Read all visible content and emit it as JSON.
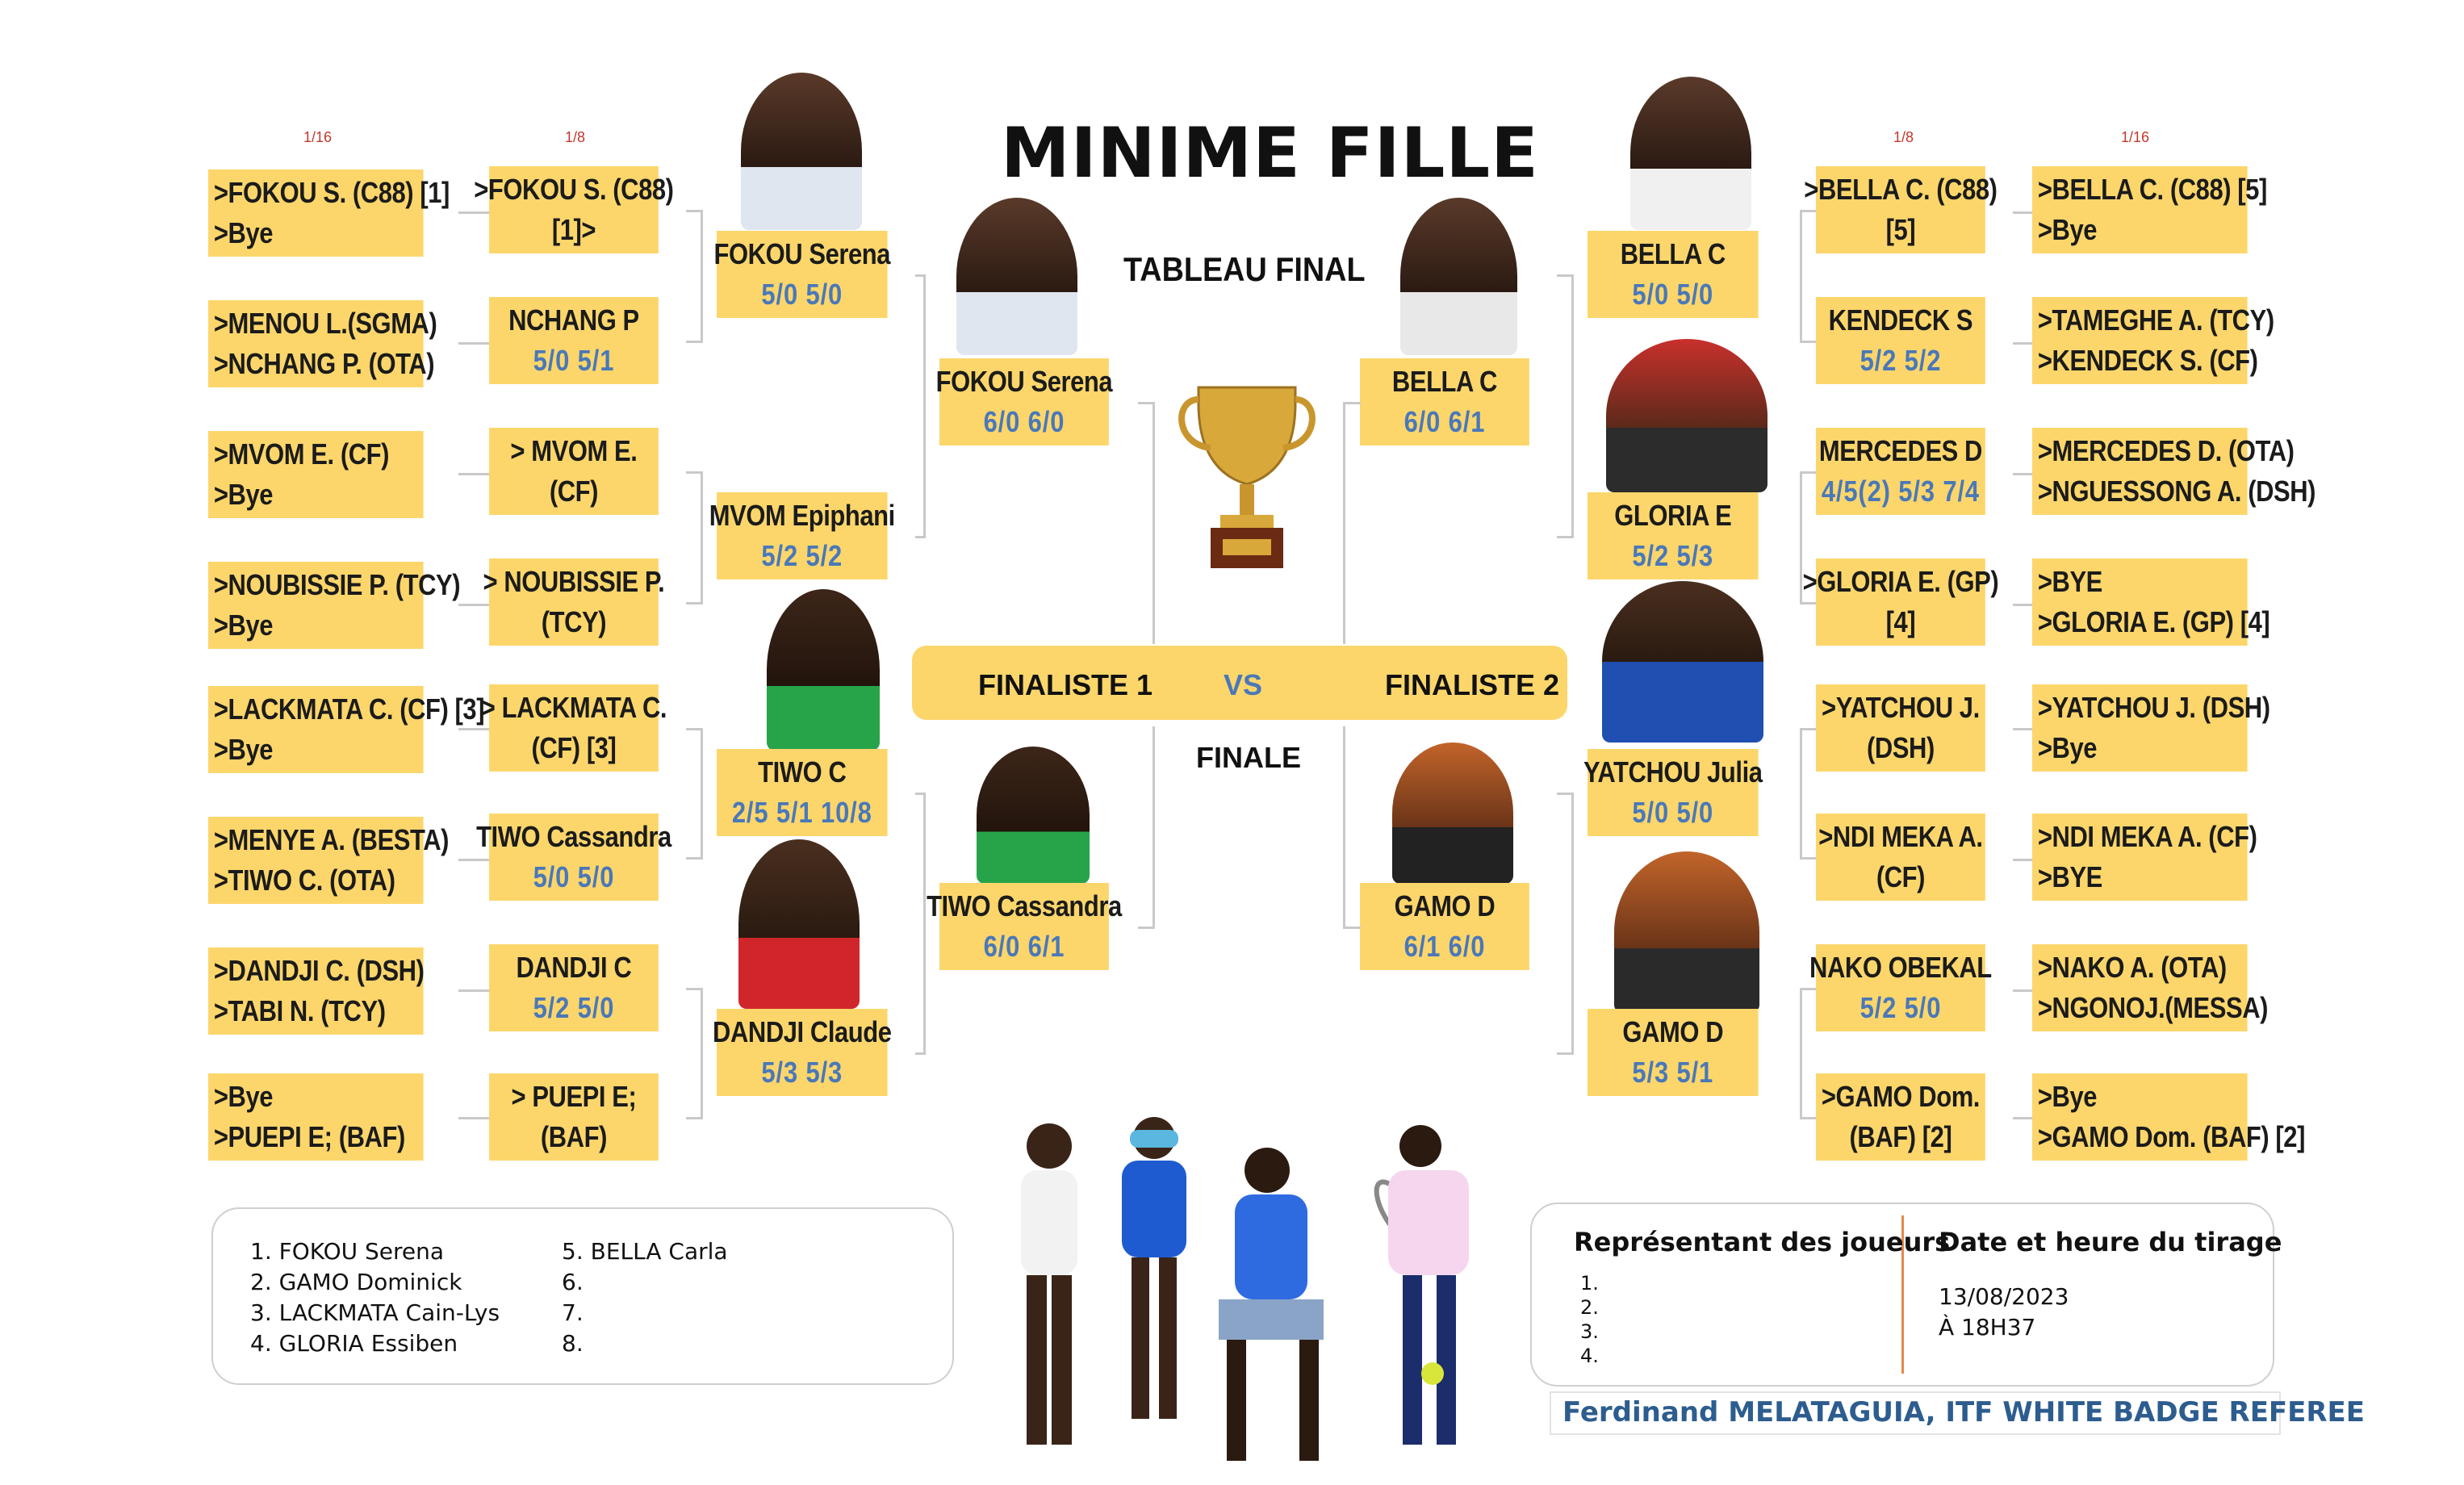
{
  "title": "MINIME FILLE",
  "subtitle": "TABLEAU FINAL",
  "finale_label": "FINALE",
  "finalist1": "FINALISTE 1",
  "vs": "VS",
  "finalist2": "FINALISTE 2",
  "round_labels": {
    "r16_left": "1/16",
    "r8_left": "1/8",
    "r8_right": "1/8",
    "r16_right": "1/16"
  },
  "left": {
    "r16": [
      [
        ">FOKOU S. (C88) [1]",
        ">Bye"
      ],
      [
        ">MENOU L.(SGMA)",
        ">NCHANG P. (OTA)"
      ],
      [
        ">MVOM E. (CF)",
        ">Bye"
      ],
      [
        ">NOUBISSIE P. (TCY)",
        ">Bye"
      ],
      [
        ">LACKMATA C. (CF) [3]",
        ">Bye"
      ],
      [
        ">MENYE A. (BESTA)",
        ">TIWO C. (OTA)"
      ],
      [
        ">DANDJI C. (DSH)",
        ">TABI N. (TCY)"
      ],
      [
        ">Bye",
        ">PUEPI E; (BAF)"
      ]
    ],
    "r8": [
      [
        ">FOKOU S. (C88)",
        "[1]>"
      ],
      [
        "NCHANG P",
        "5/0 5/1"
      ],
      [
        "> MVOM E.",
        "(CF)"
      ],
      [
        "> NOUBISSIE P.",
        "(TCY)"
      ],
      [
        "> LACKMATA C.",
        "(CF) [3]"
      ],
      [
        "TIWO Cassandra",
        "5/0 5/0"
      ],
      [
        "DANDJI C",
        "5/2  5/0"
      ],
      [
        "> PUEPI E;",
        "(BAF)"
      ]
    ],
    "qf": [
      [
        "FOKOU  Serena",
        "5/0  5/0"
      ],
      [
        "MVOM Epiphani",
        "5/2  5/2"
      ],
      [
        "TIWO C",
        "2/5  5/1   10/8"
      ],
      [
        "DANDJI Claude",
        "5/3  5/3"
      ]
    ],
    "sf": [
      [
        "FOKOU  Serena",
        "6/0  6/0"
      ],
      [
        "TIWO Cassandra",
        "6/0  6/1"
      ]
    ]
  },
  "right": {
    "sf": [
      [
        "BELLA C",
        "6/0  6/1"
      ],
      [
        "GAMO D",
        "6/1  6/0"
      ]
    ],
    "qf": [
      [
        "BELLA C",
        "5/0  5/0"
      ],
      [
        "GLORIA E",
        "5/2  5/3"
      ],
      [
        "YATCHOU Julia",
        "5/0  5/0"
      ],
      [
        "GAMO D",
        "5/3  5/1"
      ]
    ],
    "r8": [
      [
        ">BELLA C. (C88)",
        "[5]"
      ],
      [
        "KENDECK  S",
        "5/2  5/2"
      ],
      [
        "MERCEDES D",
        "4/5(2)  5/3  7/4"
      ],
      [
        ">GLORIA E. (GP)",
        "[4]"
      ],
      [
        ">YATCHOU J.",
        "(DSH)"
      ],
      [
        ">NDI MEKA A.",
        "(CF)"
      ],
      [
        "NAKO OBEKAL",
        "5/2  5/0"
      ],
      [
        ">GAMO Dom.",
        "(BAF) [2]"
      ]
    ],
    "r16": [
      [
        ">BELLA C. (C88) [5]",
        ">Bye"
      ],
      [
        ">TAMEGHE A. (TCY)",
        ">KENDECK S. (CF)"
      ],
      [
        ">MERCEDES D. (OTA)",
        ">NGUESSONG A. (DSH)"
      ],
      [
        ">BYE",
        ">GLORIA E. (GP) [4]"
      ],
      [
        ">YATCHOU J. (DSH)",
        ">Bye"
      ],
      [
        ">NDI  MEKA A. (CF)",
        ">BYE"
      ],
      [
        ">NAKO A. (OTA)",
        ">NGONOJ.(MESSA)"
      ],
      [
        ">Bye",
        ">GAMO Dom. (BAF) [2]"
      ]
    ]
  },
  "seeds_panel": {
    "col1": [
      "1. FOKOU Serena",
      "2. GAMO Dominick",
      "3. LACKMATA Cain-Lys",
      "4. GLORIA Essiben"
    ],
    "col2": [
      "5. BELLA Carla",
      "6.",
      "7.",
      "8."
    ]
  },
  "info_panel": {
    "rep_title": "Représentant des joueurs",
    "rep_items": [
      "1.",
      "2.",
      "3.",
      "4."
    ],
    "date_title": "Date et heure du tirage",
    "date": "13/08/2023",
    "time": "À 18H37"
  },
  "referee": "Ferdinand MELATAGUIA, ITF WHITE BADGE REFEREE",
  "colors": {
    "box": "#fcd66b",
    "score": "#4a78b8",
    "connector": "#c9c9c9",
    "round_label": "#c0392b",
    "referee": "#2d5d8f"
  }
}
